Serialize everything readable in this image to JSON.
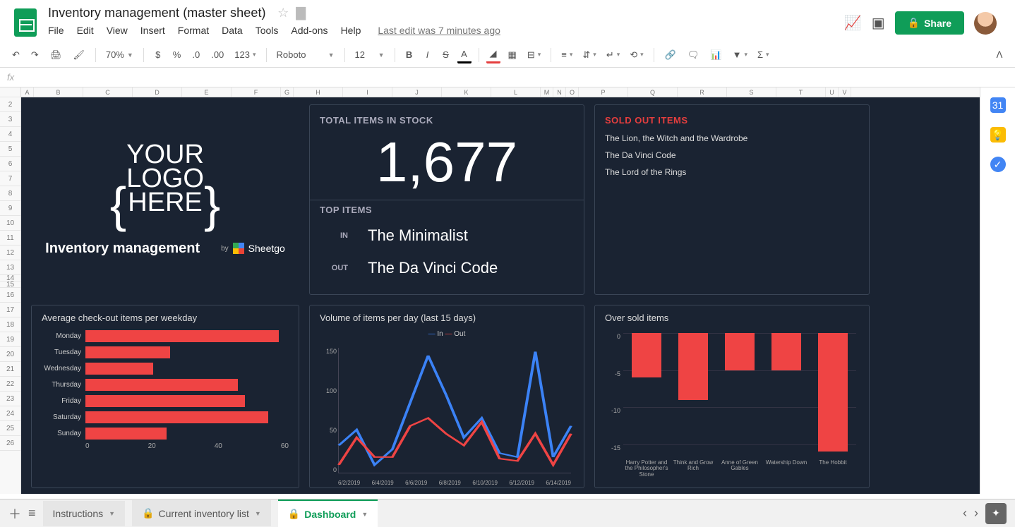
{
  "doc": {
    "title": "Inventory management (master sheet)",
    "last_edit": "Last edit was 7 minutes ago"
  },
  "menu": {
    "file": "File",
    "edit": "Edit",
    "view": "View",
    "insert": "Insert",
    "format": "Format",
    "data": "Data",
    "tools": "Tools",
    "addons": "Add-ons",
    "help": "Help"
  },
  "header_buttons": {
    "share": "Share"
  },
  "toolbar": {
    "zoom": "70%",
    "font": "Roboto",
    "size": "12",
    "more": "123"
  },
  "columns": [
    "A",
    "B",
    "C",
    "D",
    "E",
    "F",
    "G",
    "H",
    "I",
    "J",
    "K",
    "L",
    "M",
    "N",
    "O",
    "P",
    "Q",
    "R",
    "S",
    "T",
    "U",
    "V"
  ],
  "rows": [
    "2",
    "3",
    "4",
    "5",
    "6",
    "7",
    "8",
    "9",
    "10",
    "11",
    "12",
    "13",
    "14",
    "15",
    "16",
    "17",
    "18",
    "19",
    "20",
    "21",
    "22",
    "23",
    "24",
    "25",
    "26"
  ],
  "dashboard": {
    "logo_placeholder": {
      "line1": "YOUR",
      "line2": "LOGO",
      "line3": "HERE"
    },
    "inv_title": "Inventory management",
    "sheetgo_by": "by",
    "sheetgo": "Sheetgo",
    "total_label": "TOTAL ITEMS IN STOCK",
    "total_value": "1,677",
    "top_items_label": "TOP ITEMS",
    "in_label": "IN",
    "in_value": "The Minimalist",
    "out_label": "OUT",
    "out_value": "The Da Vinci Code",
    "sold_out_label": "SOLD OUT ITEMS",
    "sold_out_items": [
      "The Lion, the Witch and the Wardrobe",
      "The Da Vinci Code",
      "The Lord of the Rings"
    ],
    "chart1_title": "Average check-out items per weekday",
    "chart2_title": "Volume of items per day (last 15 days)",
    "chart3_title": "Over sold items",
    "legend_in": "In",
    "legend_out": "Out"
  },
  "chart_data": [
    {
      "type": "bar",
      "orientation": "horizontal",
      "title": "Average check-out items per weekday",
      "categories": [
        "Monday",
        "Tuesday",
        "Wednesday",
        "Thursday",
        "Friday",
        "Saturday",
        "Sunday"
      ],
      "values": [
        57,
        25,
        20,
        45,
        47,
        54,
        24
      ],
      "xlabel": "",
      "ylabel": "",
      "xlim": [
        0,
        60
      ],
      "xticks": [
        0,
        20,
        40,
        60
      ]
    },
    {
      "type": "line",
      "title": "Volume of items per day (last 15 days)",
      "x": [
        "6/2/2019",
        "6/3/2019",
        "6/4/2019",
        "6/5/2019",
        "6/6/2019",
        "6/7/2019",
        "6/8/2019",
        "6/9/2019",
        "6/10/2019",
        "6/11/2019",
        "6/12/2019",
        "6/13/2019",
        "6/14/2019",
        "6/15/2019"
      ],
      "series": [
        {
          "name": "In",
          "values": [
            35,
            55,
            10,
            30,
            90,
            150,
            100,
            45,
            70,
            25,
            20,
            155,
            20,
            60
          ]
        },
        {
          "name": "Out",
          "values": [
            10,
            45,
            20,
            20,
            60,
            70,
            50,
            35,
            65,
            18,
            15,
            50,
            10,
            50
          ]
        }
      ],
      "ylim": [
        0,
        160
      ],
      "yticks": [
        0,
        50,
        100,
        150
      ],
      "xticks": [
        "6/2/2019",
        "6/4/2019",
        "6/6/2019",
        "6/8/2019",
        "6/10/2019",
        "6/12/2019",
        "6/14/2019"
      ]
    },
    {
      "type": "bar",
      "title": "Over sold items",
      "categories": [
        "Harry Potter and the Philosopher's Stone",
        "Think and Grow Rich",
        "Anne of Green Gables",
        "Watership Down",
        "The Hobbit"
      ],
      "values": [
        -6,
        -9,
        -5,
        -5,
        -16
      ],
      "ylim": [
        -16,
        0
      ],
      "yticks": [
        0,
        -5,
        -10,
        -15
      ]
    }
  ],
  "tabs": {
    "instructions": "Instructions",
    "inventory": "Current inventory list",
    "dashboard": "Dashboard"
  }
}
